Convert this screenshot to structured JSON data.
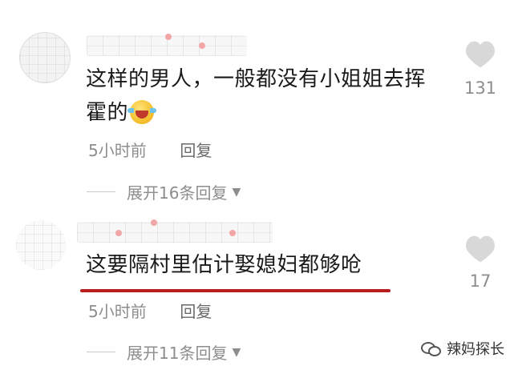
{
  "comments": [
    {
      "text": "这样的男人，一般都没有小姐姐去挥霍的",
      "emoji": "laughing-crying-emoji",
      "time": "5小时前",
      "reply_label": "回复",
      "expand_label": "展开16条回复",
      "likes": "131"
    },
    {
      "text": "这要隔村里估计娶媳妇都够呛",
      "time": "5小时前",
      "reply_label": "回复",
      "expand_label": "展开11条回复",
      "likes": "17"
    }
  ],
  "watermark": {
    "icon": "wechat-icon",
    "label": "辣妈探长"
  },
  "colors": {
    "underline": "#b81c1c",
    "heart": "#d8d8d8",
    "meta_text": "#8d8d8d"
  }
}
